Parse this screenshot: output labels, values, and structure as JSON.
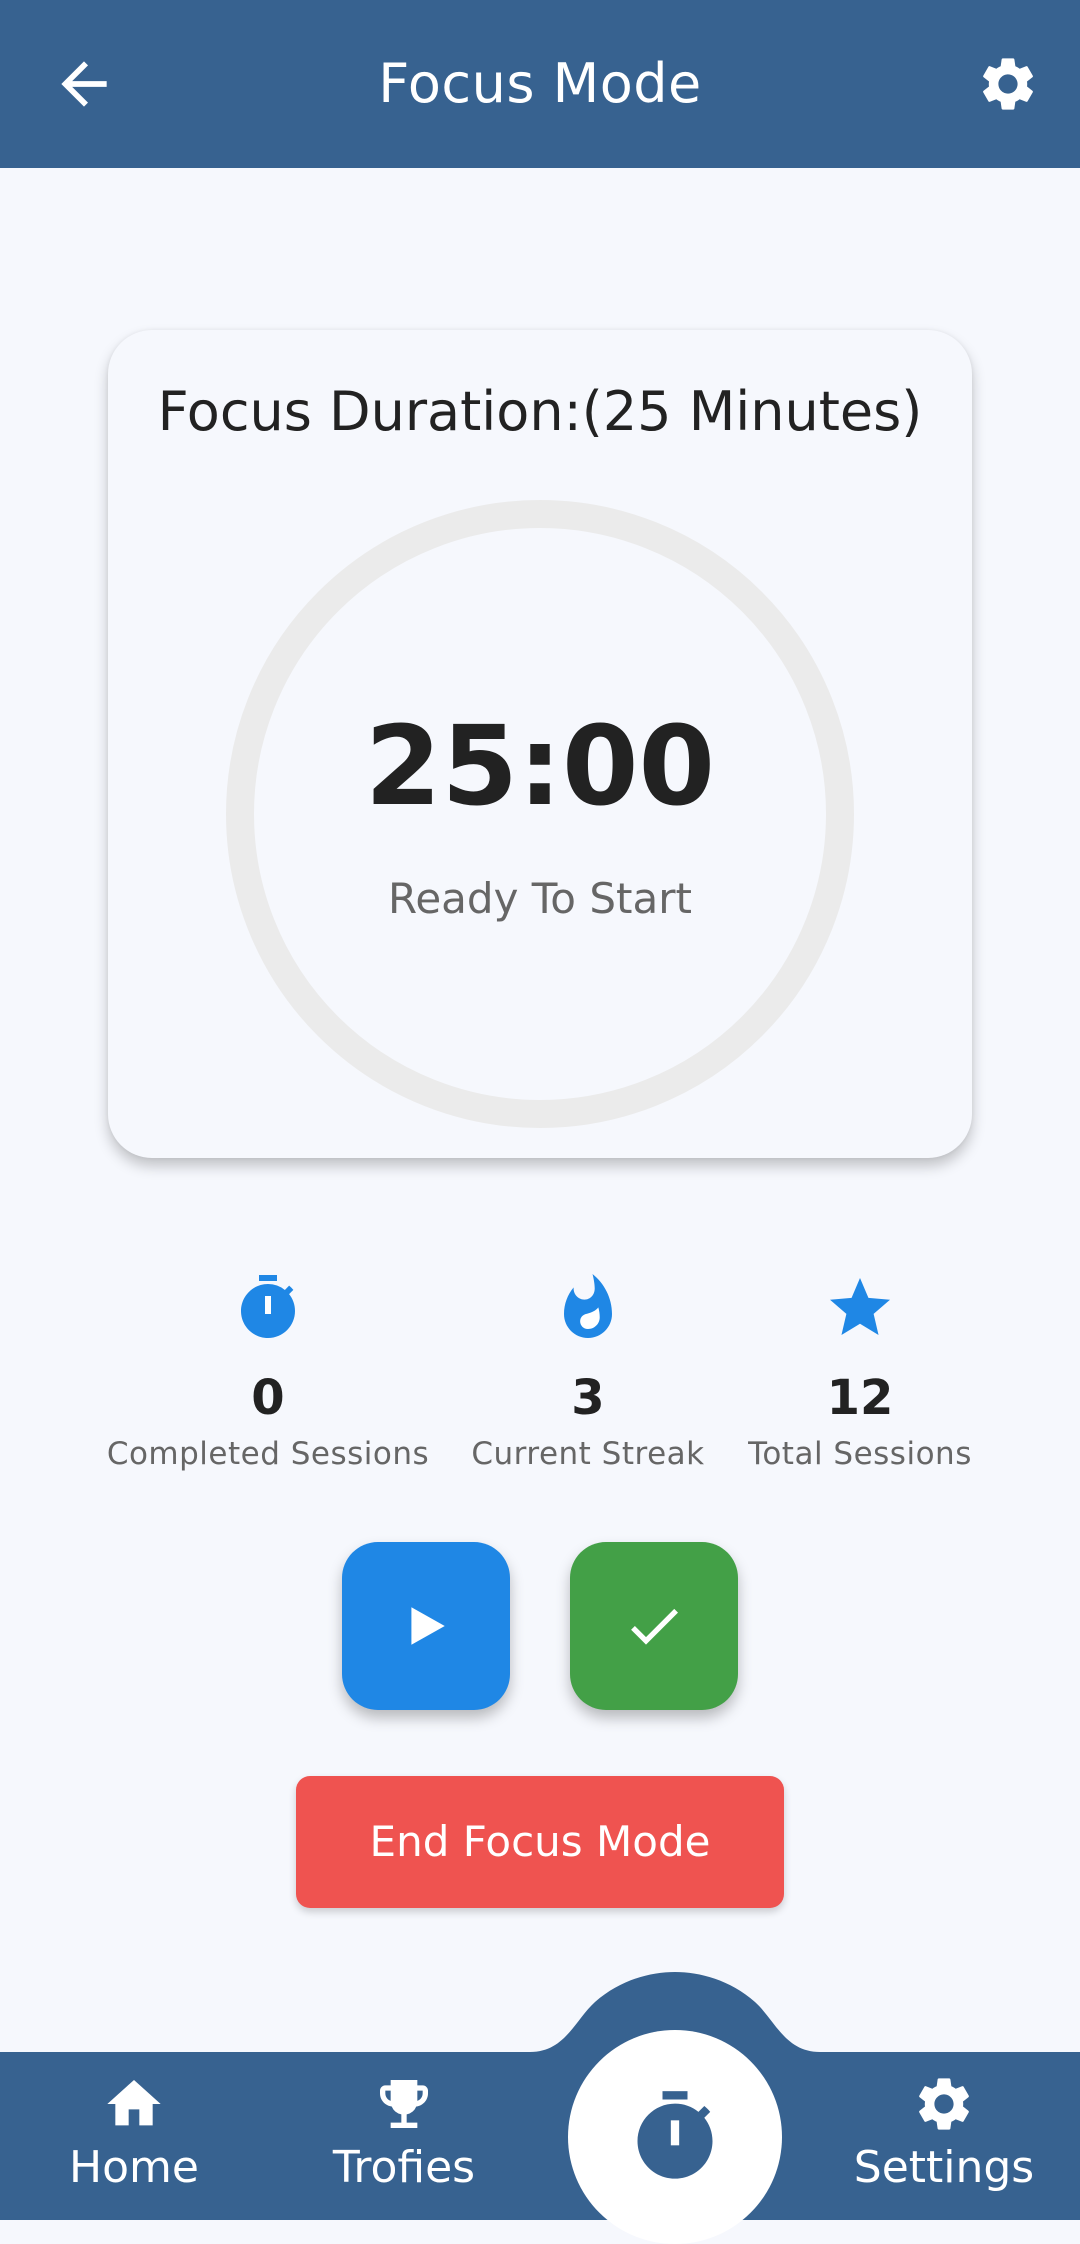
{
  "app_bar": {
    "title": "Focus Mode",
    "back_icon": "arrow-left-icon",
    "settings_icon": "gear-icon"
  },
  "timer_card": {
    "duration_label": "Focus Duration:(25 Minutes)",
    "time": "25:00",
    "status": "Ready To Start",
    "progress": 0
  },
  "stats": [
    {
      "icon": "stopwatch-icon",
      "value": "0",
      "label": "Completed Sessions"
    },
    {
      "icon": "flame-icon",
      "value": "3",
      "label": "Current Streak"
    },
    {
      "icon": "star-icon",
      "value": "12",
      "label": "Total Sessions"
    }
  ],
  "controls": {
    "play_icon": "play-icon",
    "complete_icon": "check-icon",
    "end_label": "End Focus Mode"
  },
  "bottom_nav": {
    "items": [
      {
        "icon": "home-icon",
        "label": "Home"
      },
      {
        "icon": "trophy-icon",
        "label": "Trofies"
      },
      {
        "icon": "stopwatch-icon",
        "label": ""
      },
      {
        "icon": "gear-icon",
        "label": "Settings"
      }
    ]
  },
  "colors": {
    "primary": "#376290",
    "accent_blue": "#1f87e5",
    "success_green": "#43a047",
    "danger_red": "#ef5350",
    "background": "#f6f8fd"
  }
}
